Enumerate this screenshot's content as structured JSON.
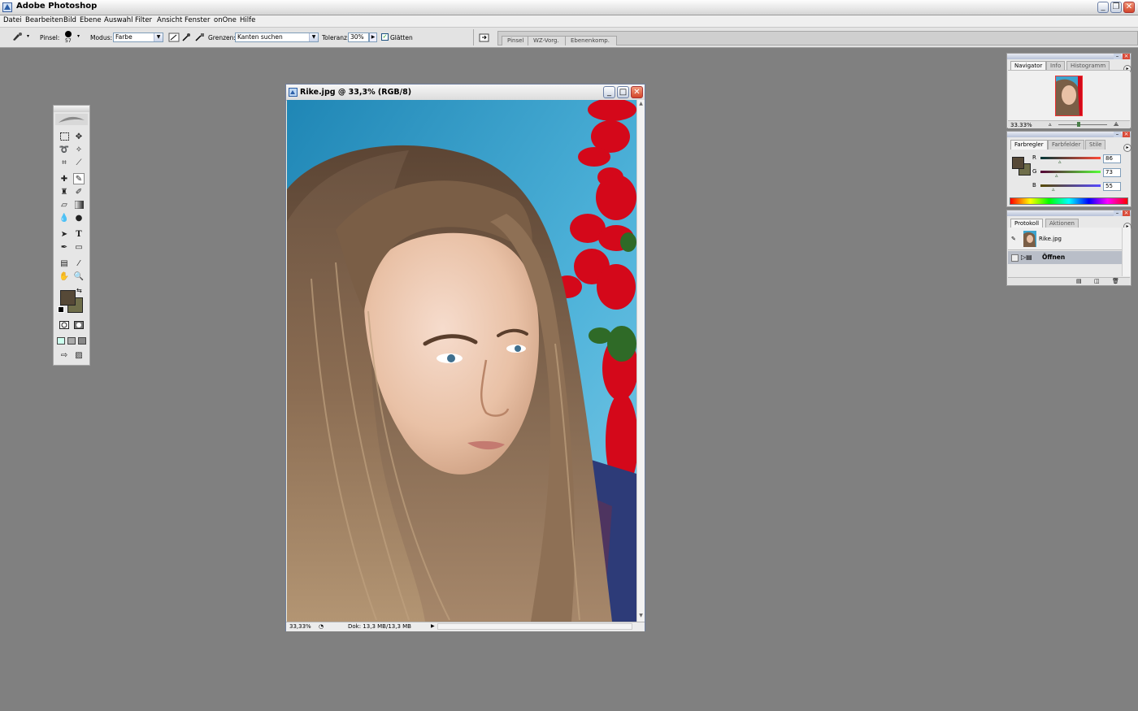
{
  "app": {
    "title": "Adobe Photoshop"
  },
  "menubar": {
    "items": [
      "Datei",
      "Bearbeiten",
      "Bild",
      "Ebene",
      "Auswahl",
      "Filter",
      "Ansicht",
      "Fenster",
      "onOne",
      "Hilfe"
    ]
  },
  "options": {
    "brush_label": "Pinsel:",
    "brush_size": "57",
    "mode_label": "Modus:",
    "mode_value": "Farbe",
    "limits_label": "Grenzen:",
    "limits_value": "Kanten suchen",
    "tolerance_label": "Toleranz:",
    "tolerance_value": "30%",
    "antialias_label": "Glätten",
    "antialias_checked": true
  },
  "palette_well": {
    "tabs": [
      "Pinsel",
      "WZ-Vorg.",
      "Ebenenkomp."
    ]
  },
  "colors": {
    "foreground": "#564937",
    "background": "#6f6e4a"
  },
  "document": {
    "title": "Rike.jpg @ 33,3% (RGB/8)",
    "zoom": "33,33%",
    "doc_size": "Dok: 13,3 MB/13,3 MB"
  },
  "navigator": {
    "tabs": [
      "Navigator",
      "Info",
      "Histogramm"
    ],
    "zoom": "33.33%"
  },
  "color_panel": {
    "tabs": [
      "Farbregler",
      "Farbfelder",
      "Stile"
    ],
    "r_label": "R",
    "g_label": "G",
    "b_label": "B",
    "r": "86",
    "g": "73",
    "b": "55"
  },
  "history_panel": {
    "tabs": [
      "Protokoll",
      "Aktionen"
    ],
    "snapshot": "Rike.jpg",
    "steps": [
      "Öffnen"
    ]
  }
}
